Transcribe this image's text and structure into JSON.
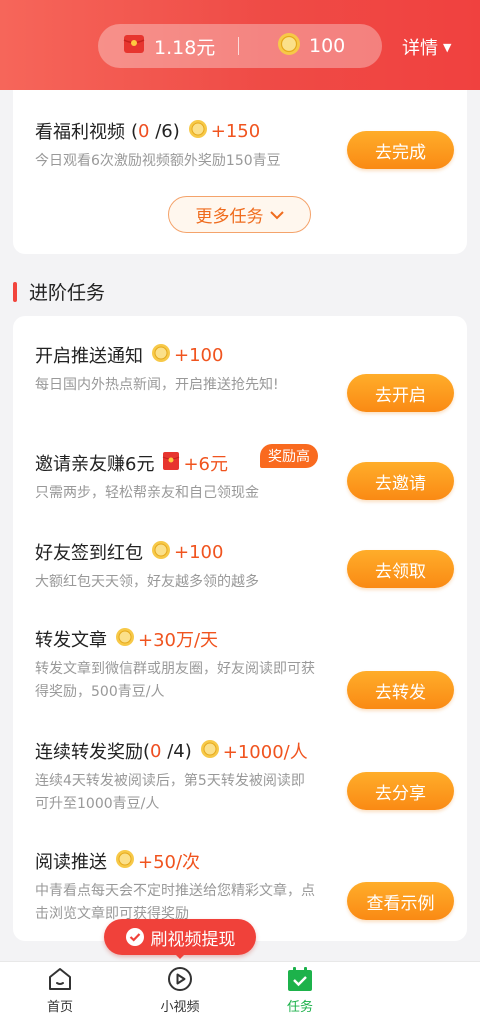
{
  "header": {
    "cash": "1.18元",
    "coins": "100",
    "details_label": "详情",
    "colors": {
      "start": "#f6665a",
      "end": "#f0413f"
    }
  },
  "top_task": {
    "title": "看福利视频",
    "progress_open": "(",
    "progress_done": "0",
    "progress_rest": " /6)",
    "reward": "+150",
    "desc": "今日观看6次激励视频额外奖励150青豆",
    "button": "去完成",
    "more_label": "更多任务"
  },
  "section": {
    "title": "进阶任务"
  },
  "tasks": [
    {
      "title": "开启推送通知",
      "reward_icon": "coin-icon",
      "reward": "+100",
      "desc": "每日国内外热点新闻，开启推送抢先知!",
      "button": "去开启"
    },
    {
      "title": "邀请亲友赚6元",
      "reward_icon": "red-packet-icon",
      "reward": "+6元",
      "badge": "奖励高",
      "desc": "只需两步，轻松帮亲友和自己领现金",
      "button": "去邀请"
    },
    {
      "title": "好友签到红包",
      "reward_icon": "coin-icon",
      "reward": "+100",
      "desc": "大额红包天天领，好友越多领的越多",
      "button": "去领取"
    },
    {
      "title": "转发文章",
      "reward_icon": "coin-icon",
      "reward": "+30万/天",
      "desc": "转发文章到微信群或朋友圈，好友阅读即可获得奖励，500青豆/人",
      "button": "去转发"
    },
    {
      "title": "连续转发奖励",
      "progress_open": " (",
      "progress_done": "0",
      "progress_rest": " /4)",
      "reward_icon": "coin-icon",
      "reward": "+1000/人",
      "desc": "连续4天转发被阅读后，第5天转发被阅读即可升至1000青豆/人",
      "button": "去分享"
    },
    {
      "title": "阅读推送",
      "reward_icon": "coin-icon",
      "reward": "+50/次",
      "desc": "中青看点每天会不定时推送给您精彩文章，点击浏览文章即可获得奖励",
      "button": "查看示例"
    }
  ],
  "float_button": {
    "label": "刷视频提现"
  },
  "tabbar": {
    "items": [
      {
        "label": "首页",
        "icon": "home-icon"
      },
      {
        "label": "小视频",
        "icon": "play-icon"
      },
      {
        "label": "任务",
        "icon": "task-check-icon",
        "active": true
      }
    ],
    "active_color": "#1db24b"
  }
}
